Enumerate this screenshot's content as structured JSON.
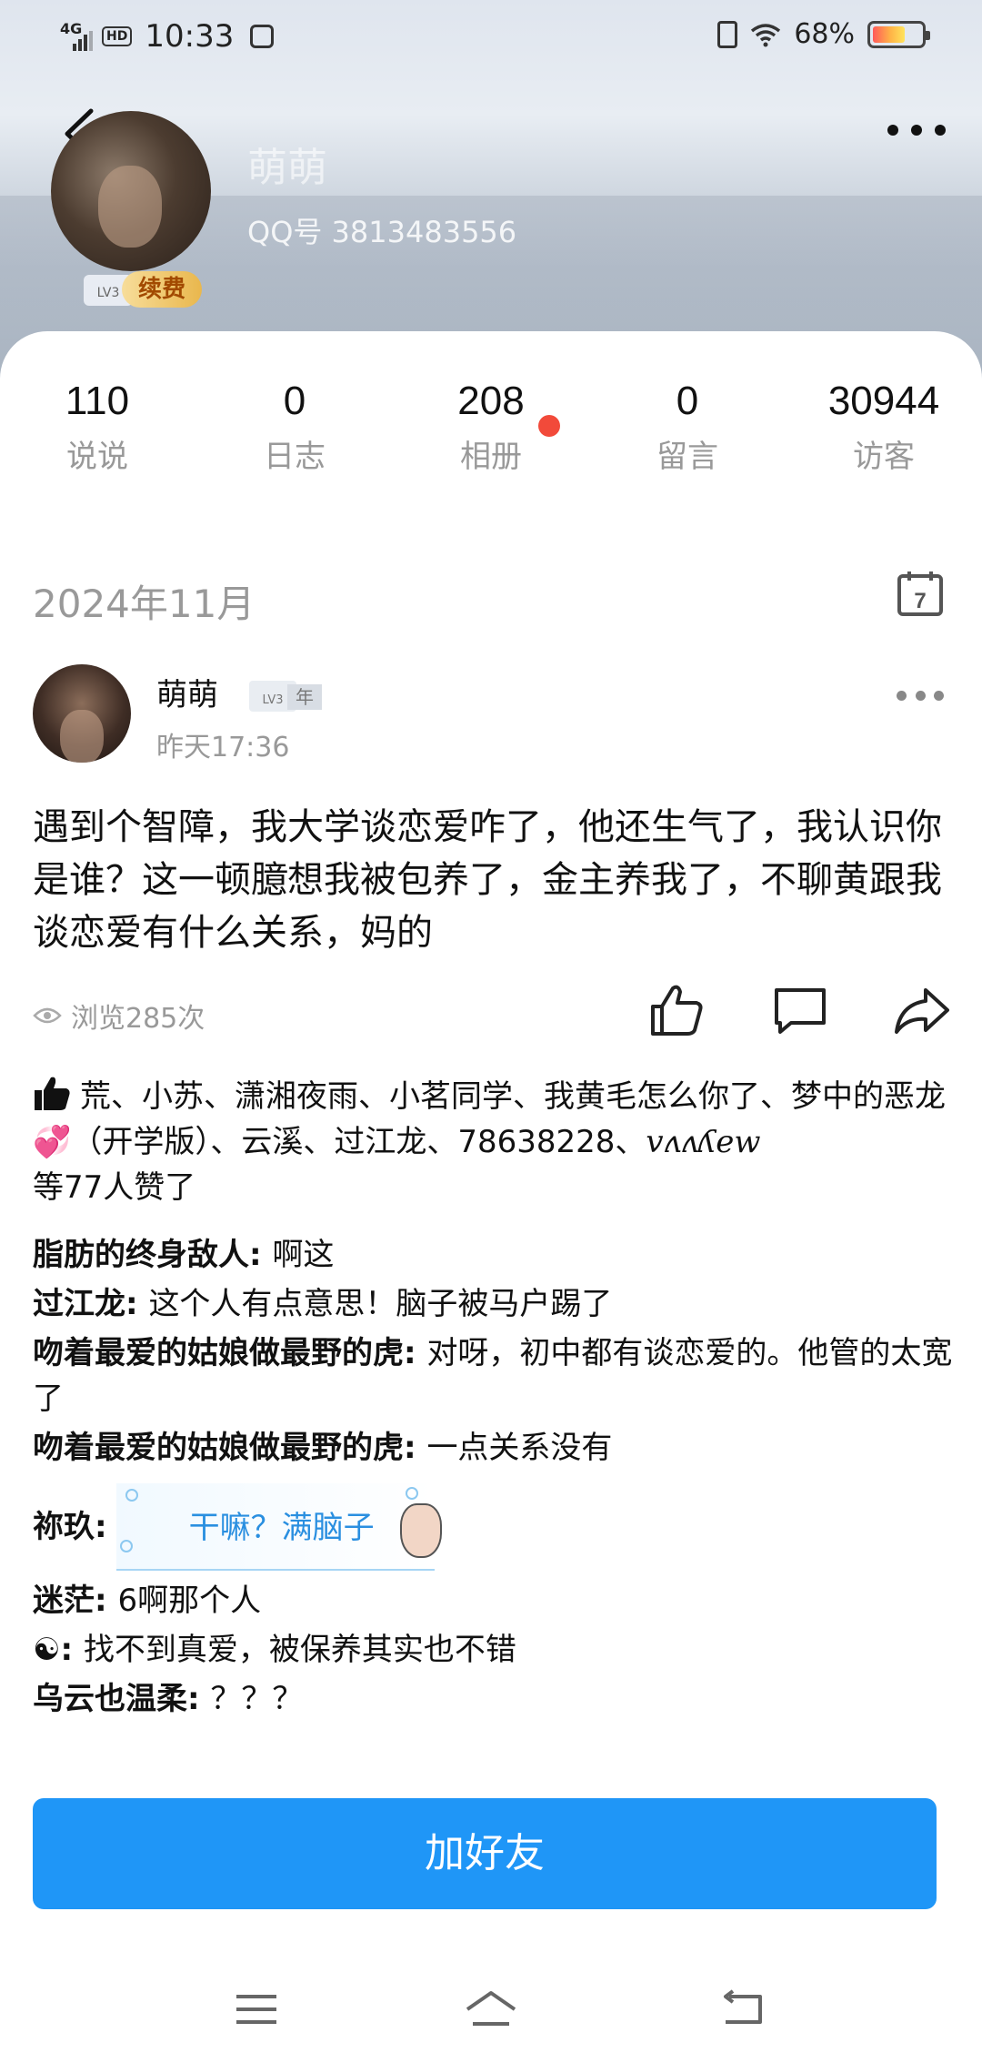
{
  "status_bar": {
    "network": "4G",
    "hd": "HD",
    "time": "10:33",
    "battery_percent": "68%",
    "battery_level": 0.68
  },
  "profile": {
    "name": "萌萌",
    "qq_number": "QQ号 3813483556",
    "vip_level": "LV3",
    "vip_renew": "续费"
  },
  "stats": [
    {
      "value": "110",
      "label": "说说"
    },
    {
      "value": "0",
      "label": "日志"
    },
    {
      "value": "208",
      "label": "相册"
    },
    {
      "value": "0",
      "label": "留言"
    },
    {
      "value": "30944",
      "label": "访客"
    }
  ],
  "feed": {
    "month": "2024年11月",
    "calendar_day": "7"
  },
  "post": {
    "author": "萌萌",
    "badge_level": "LV3",
    "badge_year": "年",
    "time": "昨天17:36",
    "content": "遇到个智障，我大学谈恋爱咋了，他还生气了，我认识你是谁？这一顿臆想我被包养了，金主养我了，不聊黄跟我谈恋爱有什么关系，妈的",
    "views": "浏览285次",
    "likes_names": "荒、小苏、潇湘夜雨、小茗同学、我黄毛怎么你了、梦中的恶龙",
    "likes_heart": "💞",
    "likes_names_2": "（开学版）、云溪、过江龙、78638228、",
    "likes_signature": "vʌʌʎew",
    "likes_summary": "等77人赞了"
  },
  "comments": [
    {
      "author": "脂肪的终身敌人",
      "text": "啊这"
    },
    {
      "author": "过江龙",
      "text": "这个人有点意思！脑子被马户踢了"
    },
    {
      "author": "吻着最爱的姑娘做最野的虎",
      "text": "对呀，初中都有谈恋爱的。他管的太宽了"
    },
    {
      "author": "吻着最爱的姑娘做最野的虎",
      "text": "一点关系没有"
    },
    {
      "author": "祢玖",
      "sticker_text": "干嘛？满脑子"
    },
    {
      "author": "迷茫",
      "text": "6啊那个人"
    },
    {
      "author": "☯",
      "text": "找不到真爱，被保养其实也不错"
    },
    {
      "author": "乌云也温柔",
      "text": "？？？"
    }
  ],
  "actions": {
    "add_friend": "加好友"
  },
  "colors": {
    "accent_blue": "#1f96f7",
    "badge_red": "#f24a3a",
    "muted_gray": "#999999"
  },
  "icons": [
    "back-arrow-icon",
    "more-icon",
    "calendar-icon",
    "eye-icon",
    "like-icon",
    "comment-icon",
    "share-icon",
    "thumb-icon",
    "menu-icon",
    "home-icon",
    "back-nav-icon"
  ]
}
